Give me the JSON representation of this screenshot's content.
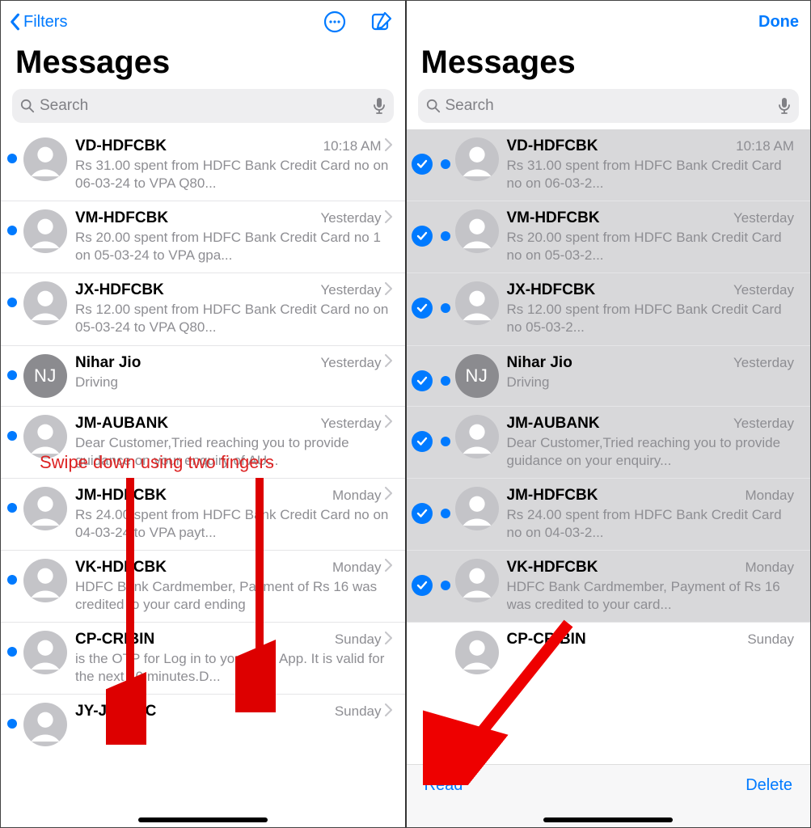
{
  "left": {
    "filters": "Filters",
    "title": "Messages",
    "search_placeholder": "Search",
    "annotation": "Swipe down using two fingers",
    "rows": [
      {
        "sender": "VD-HDFCBK",
        "time": "10:18 AM",
        "preview": "Rs 31.00 spent from HDFC Bank Credit Card no          on 06-03-24 to VPA Q80...",
        "avatar": ""
      },
      {
        "sender": "VM-HDFCBK",
        "time": "Yesterday",
        "preview": "Rs 20.00 spent from HDFC Bank Credit Card no        1 on 05-03-24 to VPA gpa...",
        "avatar": ""
      },
      {
        "sender": "JX-HDFCBK",
        "time": "Yesterday",
        "preview": "Rs 12.00 spent from HDFC Bank Credit Card no          on 05-03-24 to VPA Q80...",
        "avatar": ""
      },
      {
        "sender": "Nihar Jio",
        "time": "Yesterday",
        "preview": "Driving",
        "avatar": "NJ"
      },
      {
        "sender": "JM-AUBANK",
        "time": "Yesterday",
        "preview": "Dear Customer,Tried reaching you to provide guidance on your enquiry of AU...",
        "avatar": ""
      },
      {
        "sender": "JM-HDFCBK",
        "time": "Monday",
        "preview": "Rs 24.00 spent from HDFC Bank Credit Card no          on 04-03-24 to VPA payt...",
        "avatar": ""
      },
      {
        "sender": "VK-HDFCBK",
        "time": "Monday",
        "preview": "HDFC Bank Cardmember, Payment of Rs 16 was credited to your card ending",
        "avatar": ""
      },
      {
        "sender": "CP-CRIBIN",
        "time": "Sunday",
        "preview": "     is the OTP for Log in to your Crib App. It is valid for the next 10 minutes.D...",
        "avatar": ""
      },
      {
        "sender": "JY-JIOVOC",
        "time": "Sunday",
        "preview": "",
        "avatar": ""
      }
    ]
  },
  "right": {
    "done": "Done",
    "title": "Messages",
    "search_placeholder": "Search",
    "read": "Read",
    "delete": "Delete",
    "rows": [
      {
        "sender": "VD-HDFCBK",
        "time": "10:18 AM",
        "preview": "Rs 31.00 spent from HDFC Bank Credit Card no          on 06-03-2...",
        "avatar": ""
      },
      {
        "sender": "VM-HDFCBK",
        "time": "Yesterday",
        "preview": "Rs 20.00 spent from HDFC Bank Credit Card no          on 05-03-2...",
        "avatar": ""
      },
      {
        "sender": "JX-HDFCBK",
        "time": "Yesterday",
        "preview": "Rs 12.00 spent from HDFC Bank Credit Card no          05-03-2...",
        "avatar": ""
      },
      {
        "sender": "Nihar Jio",
        "time": "Yesterday",
        "preview": "Driving",
        "avatar": "NJ"
      },
      {
        "sender": "JM-AUBANK",
        "time": "Yesterday",
        "preview": "Dear Customer,Tried reaching you to provide guidance on your enquiry...",
        "avatar": ""
      },
      {
        "sender": "JM-HDFCBK",
        "time": "Monday",
        "preview": "Rs 24.00 spent from HDFC Bank Credit Card no          on 04-03-2...",
        "avatar": ""
      },
      {
        "sender": "VK-HDFCBK",
        "time": "Monday",
        "preview": "HDFC Bank Cardmember, Payment of Rs 16 was credited to your card...",
        "avatar": ""
      },
      {
        "sender": "CP-CRIBIN",
        "time": "Sunday",
        "preview": "",
        "avatar": ""
      }
    ]
  }
}
